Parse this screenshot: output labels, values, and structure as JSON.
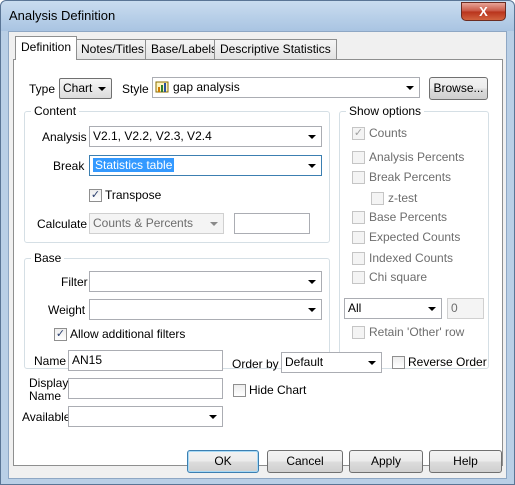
{
  "window": {
    "title": "Analysis Definition",
    "close_glyph": "X"
  },
  "tabs": [
    {
      "label": "Definition",
      "active": true
    },
    {
      "label": "Notes/Titles",
      "active": false
    },
    {
      "label": "Base/Labels",
      "active": false
    },
    {
      "label": "Descriptive Statistics",
      "active": false
    }
  ],
  "definition": {
    "type_label": "Type",
    "type_value": "Chart",
    "style_label": "Style",
    "style_value": "gap analysis",
    "style_icon": "chart-style-icon",
    "browse_label": "Browse...",
    "content": {
      "title": "Content",
      "analysis_label": "Analysis",
      "analysis_value": "V2.1, V2.2, V2.3, V2.4",
      "break_label": "Break",
      "break_value": "Statistics table",
      "transpose_label": "Transpose",
      "transpose_checked": true,
      "calculate_label": "Calculate",
      "calculate_value": "Counts & Percents",
      "calculate_extra": ""
    },
    "base": {
      "title": "Base",
      "filter_label": "Filter",
      "filter_value": "",
      "weight_label": "Weight",
      "weight_value": "",
      "allow_filters_label": "Allow additional filters",
      "allow_filters_checked": true
    },
    "show_options": {
      "title": "Show options",
      "items": [
        {
          "label": "Counts",
          "checked": true
        },
        {
          "label": "Analysis Percents",
          "checked": false
        },
        {
          "label": "Break Percents",
          "checked": false
        },
        {
          "label": "z-test",
          "checked": false
        },
        {
          "label": "Base Percents",
          "checked": false
        },
        {
          "label": "Expected Counts",
          "checked": false
        },
        {
          "label": "Indexed Counts",
          "checked": false
        },
        {
          "label": "Chi square",
          "checked": false
        }
      ],
      "all_value": "All",
      "all_number": "0",
      "retain_label": "Retain 'Other' row"
    },
    "name_label": "Name",
    "name_value": "AN15",
    "display_name_label_1": "Display",
    "display_name_label_2": "Name",
    "display_name_value": "",
    "available_label": "Available",
    "available_value": "",
    "order_by_label": "Order by",
    "order_by_value": "Default",
    "reverse_order_label": "Reverse Order",
    "hide_chart_label": "Hide Chart"
  },
  "buttons": {
    "ok": "OK",
    "cancel": "Cancel",
    "apply": "Apply",
    "help": "Help"
  },
  "check_glyph": "✓"
}
